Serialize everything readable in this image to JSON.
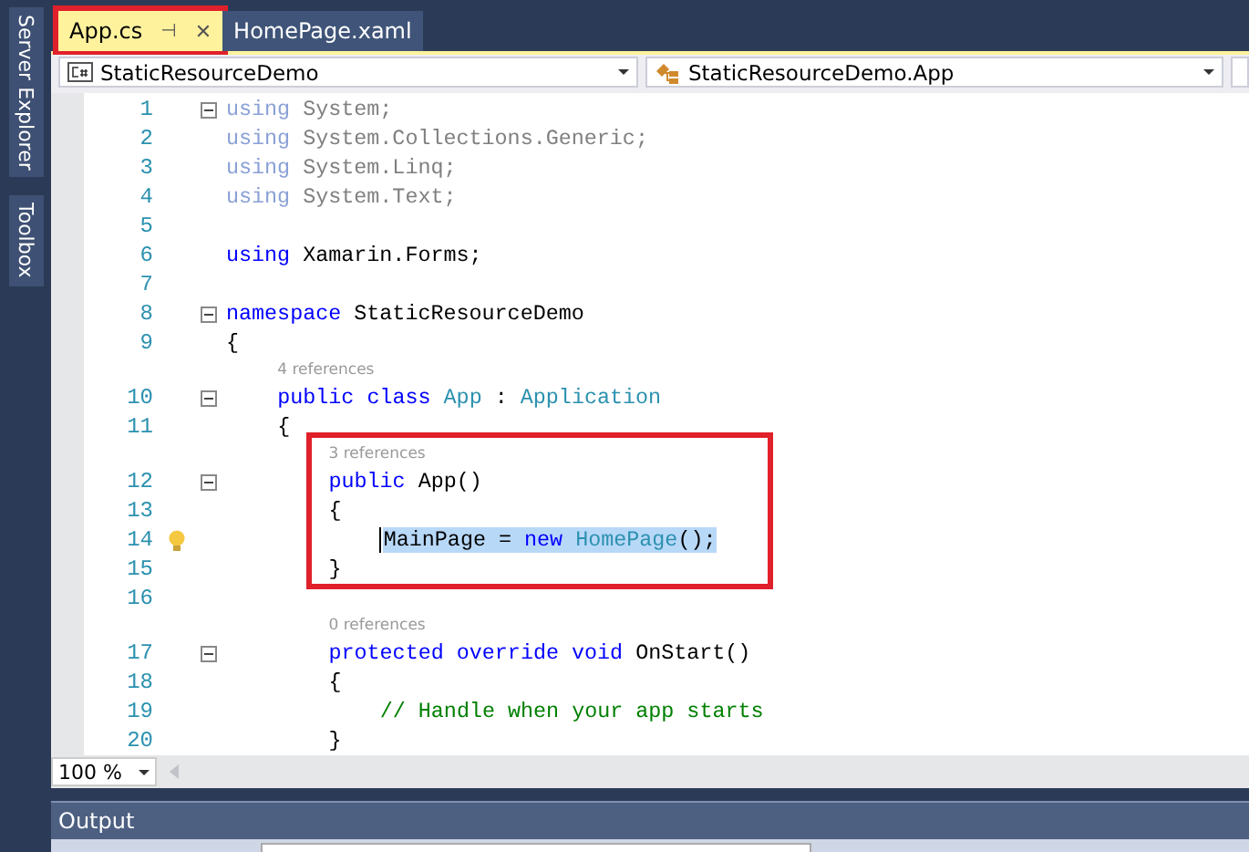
{
  "sidebar": {
    "items": [
      {
        "label": "Server Explorer"
      },
      {
        "label": "Toolbox"
      }
    ]
  },
  "tabs": [
    {
      "label": "App.cs",
      "selected": true,
      "outlined": true,
      "pin": "⊣",
      "close": "✕"
    },
    {
      "label": "HomePage.xaml",
      "selected": false,
      "outlined": false
    }
  ],
  "navigation_bar": {
    "project": "StaticResourceDemo",
    "member": "StaticResourceDemo.App"
  },
  "editor": {
    "rows": [
      {
        "kind": "code",
        "number": "1",
        "fold": true,
        "boxed": false,
        "selected": false,
        "bulb": false,
        "tokens": [
          {
            "text": "using",
            "kind": "dim_keyword"
          },
          {
            "text": " System;",
            "kind": "dim"
          }
        ]
      },
      {
        "kind": "code",
        "number": "2",
        "fold": false,
        "boxed": false,
        "selected": false,
        "bulb": false,
        "tokens": [
          {
            "text": "using",
            "kind": "dim_keyword"
          },
          {
            "text": " System.Collections.Generic;",
            "kind": "dim"
          }
        ]
      },
      {
        "kind": "code",
        "number": "3",
        "fold": false,
        "boxed": false,
        "selected": false,
        "bulb": false,
        "tokens": [
          {
            "text": "using",
            "kind": "dim_keyword"
          },
          {
            "text": " System.Linq;",
            "kind": "dim"
          }
        ]
      },
      {
        "kind": "code",
        "number": "4",
        "fold": false,
        "boxed": false,
        "selected": false,
        "bulb": false,
        "tokens": [
          {
            "text": "using",
            "kind": "dim_keyword"
          },
          {
            "text": " System.Text;",
            "kind": "dim"
          }
        ]
      },
      {
        "kind": "code",
        "number": "5",
        "fold": false,
        "boxed": false,
        "bulb": false
      },
      {
        "kind": "code",
        "number": "6",
        "fold": false,
        "boxed": false,
        "selected": false,
        "bulb": false,
        "tokens": [
          {
            "text": "using",
            "kind": "keyword"
          },
          {
            "text": " Xamarin.Forms;",
            "kind": "plain"
          }
        ]
      },
      {
        "kind": "code",
        "number": "7",
        "fold": false,
        "boxed": false,
        "bulb": false
      },
      {
        "kind": "code",
        "number": "8",
        "fold": true,
        "boxed": false,
        "selected": false,
        "bulb": false,
        "tokens": [
          {
            "text": "namespace",
            "kind": "keyword"
          },
          {
            "text": " StaticResourceDemo",
            "kind": "plain"
          }
        ]
      },
      {
        "kind": "code",
        "number": "9",
        "fold": false,
        "boxed": false,
        "selected": false,
        "bulb": false,
        "tokens": [
          {
            "text": "{",
            "kind": "plain"
          }
        ],
        "children": [
          {
            "kind": "lens",
            "text": "4 references",
            "boxed": false
          },
          {
            "kind": "code",
            "number": "10",
            "fold": true,
            "boxed": false,
            "selected": false,
            "bulb": false,
            "tokens": [
              {
                "text": "public class",
                "kind": "keyword"
              },
              {
                "text": " App",
                "kind": "type"
              },
              {
                "text": " : ",
                "kind": "plain"
              },
              {
                "text": "Application",
                "kind": "type"
              }
            ]
          },
          {
            "kind": "code",
            "number": "11",
            "fold": false,
            "boxed": false,
            "selected": false,
            "bulb": false,
            "tokens": [
              {
                "text": "{",
                "kind": "plain"
              }
            ],
            "children": [
              {
                "kind": "lens",
                "text": "3 references",
                "boxed": true
              },
              {
                "kind": "code",
                "number": "12",
                "fold": true,
                "boxed": true,
                "selected": false,
                "bulb": false,
                "tokens": [
                  {
                    "text": "public",
                    "kind": "keyword"
                  },
                  {
                    "text": " App()",
                    "kind": "plain"
                  }
                ]
              },
              {
                "kind": "code",
                "number": "13",
                "fold": false,
                "boxed": true,
                "selected": false,
                "bulb": false,
                "tokens": [
                  {
                    "text": "{",
                    "kind": "plain"
                  }
                ],
                "children": [
                  {
                    "kind": "code",
                    "number": "14",
                    "fold": false,
                    "boxed": true,
                    "selected": true,
                    "bulb": true,
                    "tokens": [
                      {
                        "text": "MainPage = ",
                        "kind": "plain"
                      },
                      {
                        "text": "new",
                        "kind": "keyword"
                      },
                      {
                        "text": " HomePage",
                        "kind": "type"
                      },
                      {
                        "text": "();",
                        "kind": "plain"
                      }
                    ]
                  }
                ]
              },
              {
                "kind": "code",
                "number": "15",
                "fold": false,
                "boxed": true,
                "selected": false,
                "bulb": false,
                "tokens": [
                  {
                    "text": "}",
                    "kind": "plain"
                  }
                ]
              },
              {
                "kind": "code",
                "number": "16",
                "fold": false,
                "boxed": false,
                "bulb": false
              },
              {
                "kind": "lens",
                "text": "0 references",
                "boxed": false
              },
              {
                "kind": "code",
                "number": "17",
                "fold": true,
                "boxed": false,
                "selected": false,
                "bulb": false,
                "tokens": [
                  {
                    "text": "protected override void",
                    "kind": "keyword"
                  },
                  {
                    "text": " OnStart()",
                    "kind": "plain"
                  }
                ]
              },
              {
                "kind": "code",
                "number": "18",
                "fold": false,
                "boxed": false,
                "selected": false,
                "bulb": false,
                "tokens": [
                  {
                    "text": "{",
                    "kind": "plain"
                  }
                ],
                "children": [
                  {
                    "kind": "code",
                    "number": "19",
                    "fold": false,
                    "boxed": false,
                    "selected": false,
                    "bulb": false,
                    "tokens": [
                      {
                        "text": "// Handle when your app starts",
                        "kind": "comment"
                      }
                    ]
                  }
                ]
              },
              {
                "kind": "code",
                "number": "20",
                "fold": false,
                "boxed": false,
                "selected": false,
                "bulb": false,
                "tokens": [
                  {
                    "text": "}",
                    "kind": "plain"
                  }
                ]
              }
            ]
          }
        ]
      }
    ],
    "zoom": "100 %"
  },
  "output_panel": {
    "title": "Output"
  }
}
